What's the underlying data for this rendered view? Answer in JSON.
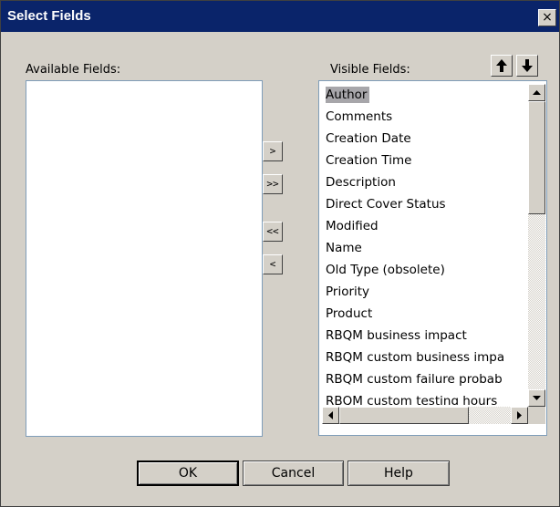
{
  "window": {
    "title": "Select Fields",
    "close_glyph": "×"
  },
  "available": {
    "label": "Available Fields:",
    "items": []
  },
  "visible": {
    "label": "Visible Fields:",
    "selected_index": 0,
    "items": [
      "Author",
      "Comments",
      "Creation Date",
      "Creation Time",
      "Description",
      "Direct Cover Status",
      "Modified",
      "Name",
      "Old Type (obsolete)",
      "Priority",
      "Product",
      "RBQM business impact",
      "RBQM custom business impa",
      "RBQM custom failure probab",
      "RBQM custom testing hours"
    ]
  },
  "move_buttons": {
    "add": ">",
    "add_all": ">>",
    "remove_all": "<<",
    "remove": "<"
  },
  "order_buttons": {
    "up_icon": "arrow-up-icon",
    "down_icon": "arrow-down-icon"
  },
  "footer": {
    "ok": "OK",
    "cancel": "Cancel",
    "help": "Help"
  }
}
